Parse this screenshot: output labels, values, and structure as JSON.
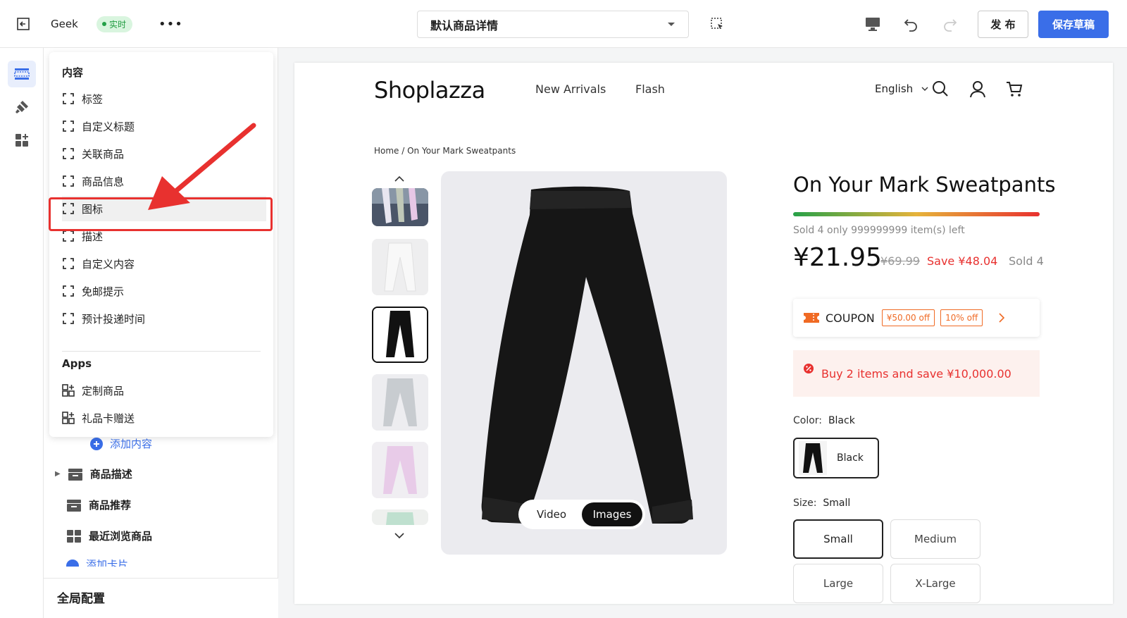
{
  "topbar": {
    "shop_name": "Geek",
    "live_badge": "实时",
    "page_select": "默认商品详情",
    "publish_label": "发 布",
    "save_draft_label": "保存草稿"
  },
  "popup": {
    "content_heading": "内容",
    "content_items": [
      "标签",
      "自定义标题",
      "关联商品",
      "商品信息",
      "图标",
      "描述",
      "自定义内容",
      "免邮提示",
      "预计投递时间"
    ],
    "apps_heading": "Apps",
    "app_items": [
      "定制商品",
      "礼品卡赠送"
    ]
  },
  "sidebar": {
    "add_content": "添加内容",
    "sections": [
      "商品描述",
      "商品推荐",
      "最近浏览商品"
    ],
    "add_card": "添加卡片",
    "global_config": "全局配置"
  },
  "store": {
    "logo": "Shoplazza",
    "nav": [
      "New Arrivals",
      "Flash"
    ],
    "language": "English",
    "breadcrumb": "Home / On Your Mark Sweatpants",
    "media_toggle": [
      "Video",
      "Images"
    ],
    "product": {
      "title": "On Your Mark Sweatpants",
      "stock_text": "Sold 4 only 999999999 item(s) left",
      "price": "¥21.95",
      "compare_price": "¥69.99",
      "save": "Save ¥48.04",
      "sold": "Sold 4",
      "coupon_label": "COUPON",
      "coupon_tags": [
        "¥50.00 off",
        "10% off"
      ],
      "promo": "Buy 2 items and save ¥10,000.00",
      "color_label": "Color:",
      "color_value": "Black",
      "color_swatch": "Black",
      "size_label": "Size:",
      "size_value": "Small",
      "sizes": [
        "Small",
        "Medium",
        "Large",
        "X-Large"
      ]
    }
  },
  "colors": {
    "accent": "#3a6ee8",
    "highlight": "#e8312f",
    "live": "#1f9b3f"
  }
}
